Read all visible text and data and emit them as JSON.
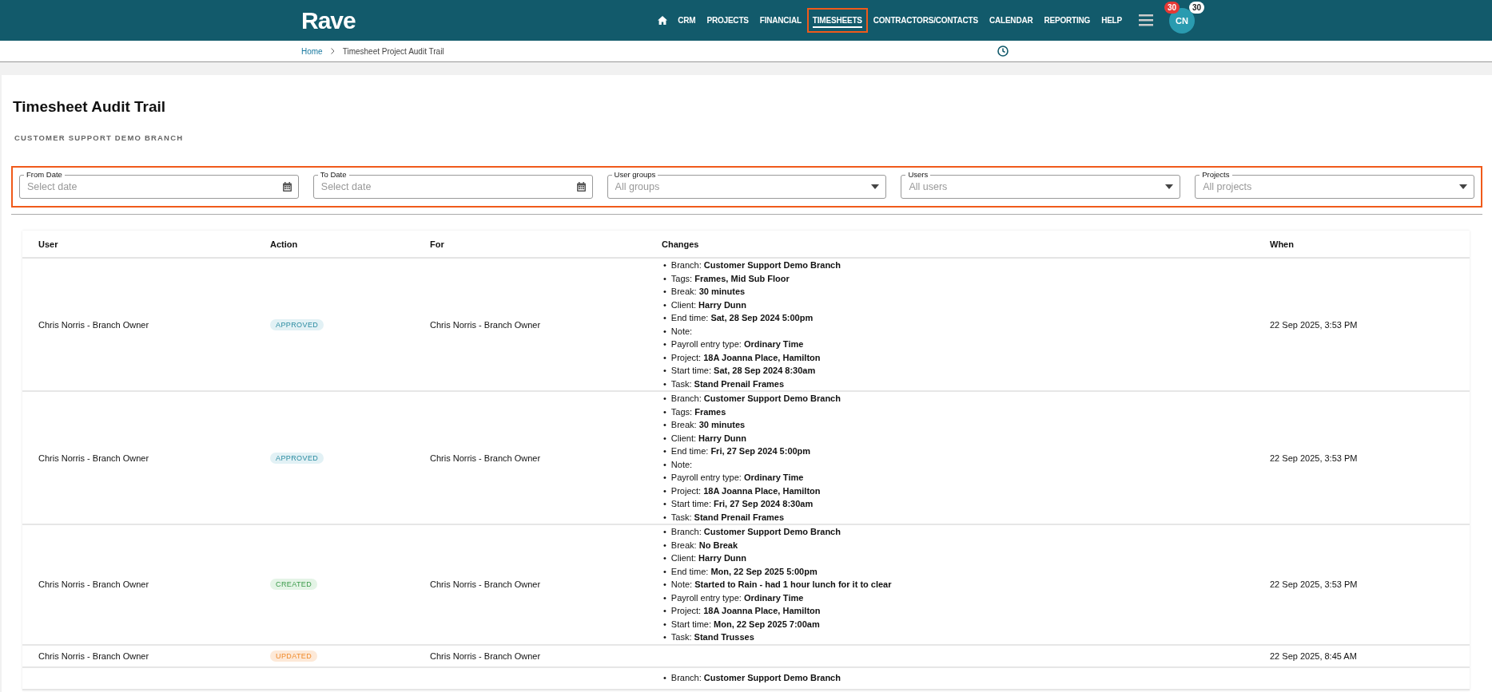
{
  "header": {
    "logo": "Rave",
    "nav": [
      {
        "label": "CRM",
        "selected": false
      },
      {
        "label": "PROJECTS",
        "selected": false
      },
      {
        "label": "FINANCIAL",
        "selected": false
      },
      {
        "label": "TIMESHEETS",
        "selected": true
      },
      {
        "label": "CONTRACTORS/CONTACTS",
        "selected": false
      },
      {
        "label": "CALENDAR",
        "selected": false
      },
      {
        "label": "REPORTING",
        "selected": false
      },
      {
        "label": "HELP",
        "selected": false
      }
    ],
    "avatar": {
      "initials": "CN",
      "badge_alert": "30",
      "badge_count": "30"
    }
  },
  "breadcrumb": [
    "Home",
    "Timesheet Project Audit Trail"
  ],
  "page": {
    "title": "Timesheet Audit Trail",
    "subtitle": "CUSTOMER SUPPORT DEMO BRANCH"
  },
  "filters": [
    {
      "kind": "date",
      "label": "From Date",
      "placeholder": "Select date"
    },
    {
      "kind": "date",
      "label": "To Date",
      "placeholder": "Select date"
    },
    {
      "kind": "select",
      "label": "User groups",
      "placeholder": "All groups"
    },
    {
      "kind": "select",
      "label": "Users",
      "placeholder": "All users"
    },
    {
      "kind": "select",
      "label": "Projects",
      "placeholder": "All projects"
    }
  ],
  "table": {
    "bullet": "•",
    "columns": [
      "User",
      "Action",
      "For",
      "Changes",
      "When"
    ],
    "rows": [
      {
        "user": "Chris Norris - Branch Owner",
        "action": {
          "label": "APPROVED",
          "kind": "approved"
        },
        "for": "Chris Norris - Branch Owner",
        "changes": [
          "Branch: **Customer Support Demo Branch**",
          "Tags: **Frames, Mid Sub Floor**",
          "Break: **30 minutes**",
          "Client: **Harry Dunn**",
          "End time: **Sat, 28 Sep 2024 5:00pm**",
          "Note:",
          "Payroll entry type: **Ordinary Time**",
          "Project: **18A Joanna Place, Hamilton**",
          "Start time: **Sat, 28 Sep 2024 8:30am**",
          "Task: **Stand Prenail Frames**"
        ],
        "when": "22 Sep 2025, 3:53 PM"
      },
      {
        "user": "Chris Norris - Branch Owner",
        "action": {
          "label": "APPROVED",
          "kind": "approved"
        },
        "for": "Chris Norris - Branch Owner",
        "changes": [
          "Branch: **Customer Support Demo Branch**",
          "Tags: **Frames**",
          "Break: **30 minutes**",
          "Client: **Harry Dunn**",
          "End time: **Fri, 27 Sep 2024 5:00pm**",
          "Note:",
          "Payroll entry type: **Ordinary Time**",
          "Project: **18A Joanna Place, Hamilton**",
          "Start time: **Fri, 27 Sep 2024 8:30am**",
          "Task: **Stand Prenail Frames**"
        ],
        "when": "22 Sep 2025, 3:53 PM"
      },
      {
        "user": "Chris Norris - Branch Owner",
        "action": {
          "label": "CREATED",
          "kind": "created"
        },
        "for": "Chris Norris - Branch Owner",
        "changes": [
          "Branch: **Customer Support Demo Branch**",
          "Break: **No Break**",
          "Client: **Harry Dunn**",
          "End time: **Mon, 22 Sep 2025 5:00pm**",
          "Note: **Started to Rain - had 1 hour lunch for it to clear**",
          "Payroll entry type: **Ordinary Time**",
          "Project: **18A Joanna Place, Hamilton**",
          "Start time: **Mon, 22 Sep 2025 7:00am**",
          "Task: **Stand Trusses**"
        ],
        "when": "22 Sep 2025, 3:53 PM"
      },
      {
        "user": "Chris Norris - Branch Owner",
        "action": {
          "label": "UPDATED",
          "kind": "updated"
        },
        "for": "Chris Norris - Branch Owner",
        "when": "22 Sep 2025, 8:45 AM"
      },
      {
        "changes": [
          "Branch: **Customer Support Demo Branch**"
        ]
      }
    ]
  }
}
